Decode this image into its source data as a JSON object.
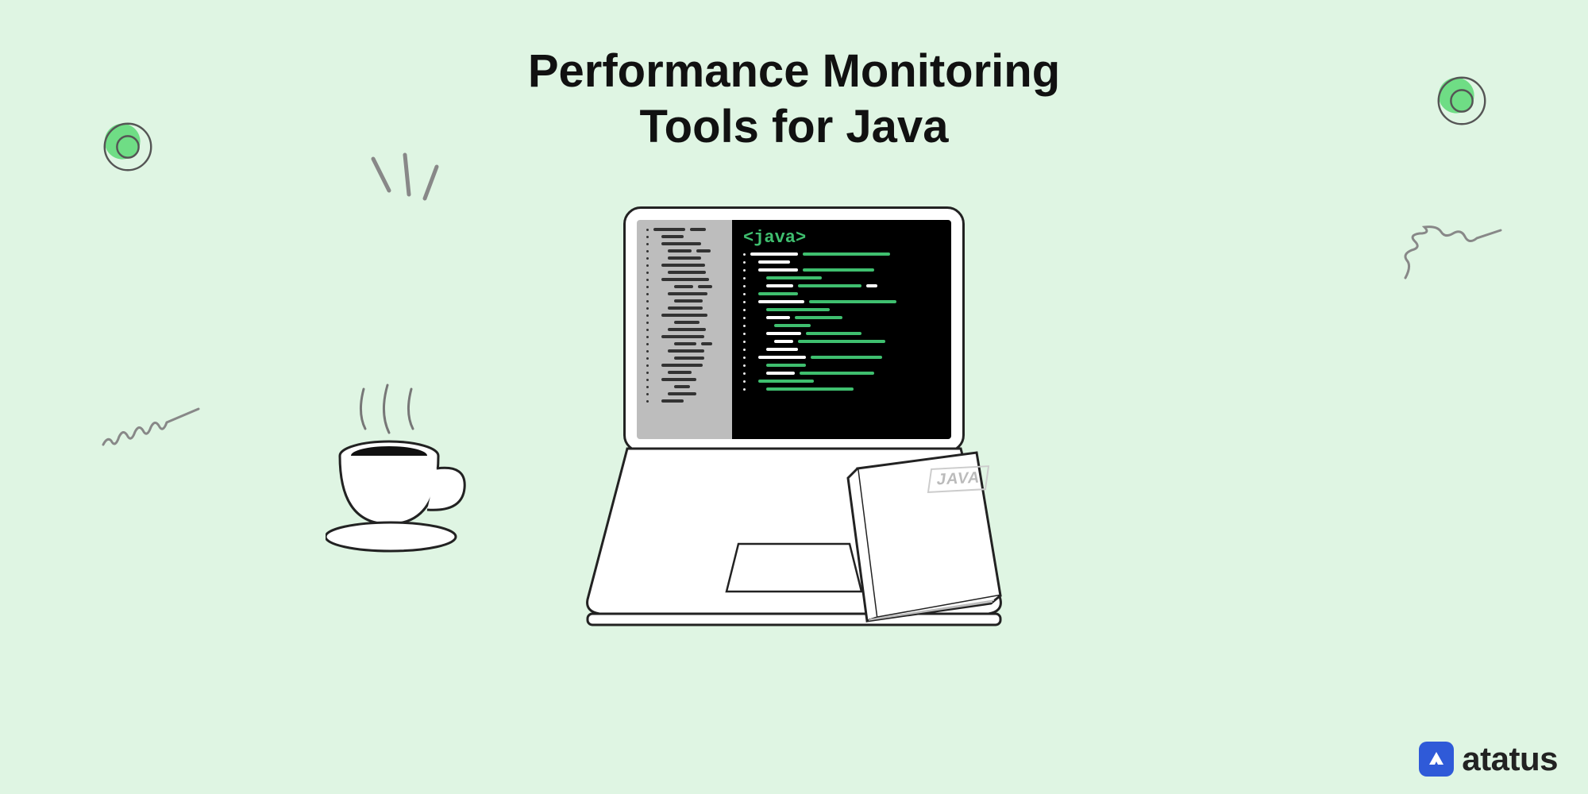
{
  "title_line1": "Performance Monitoring",
  "title_line2": "Tools for Java",
  "code_tag": "<java>",
  "book_label": "JAVA",
  "brand": "atatus",
  "accent_color": "#3fbf6f",
  "brand_color": "#2f5ad8"
}
